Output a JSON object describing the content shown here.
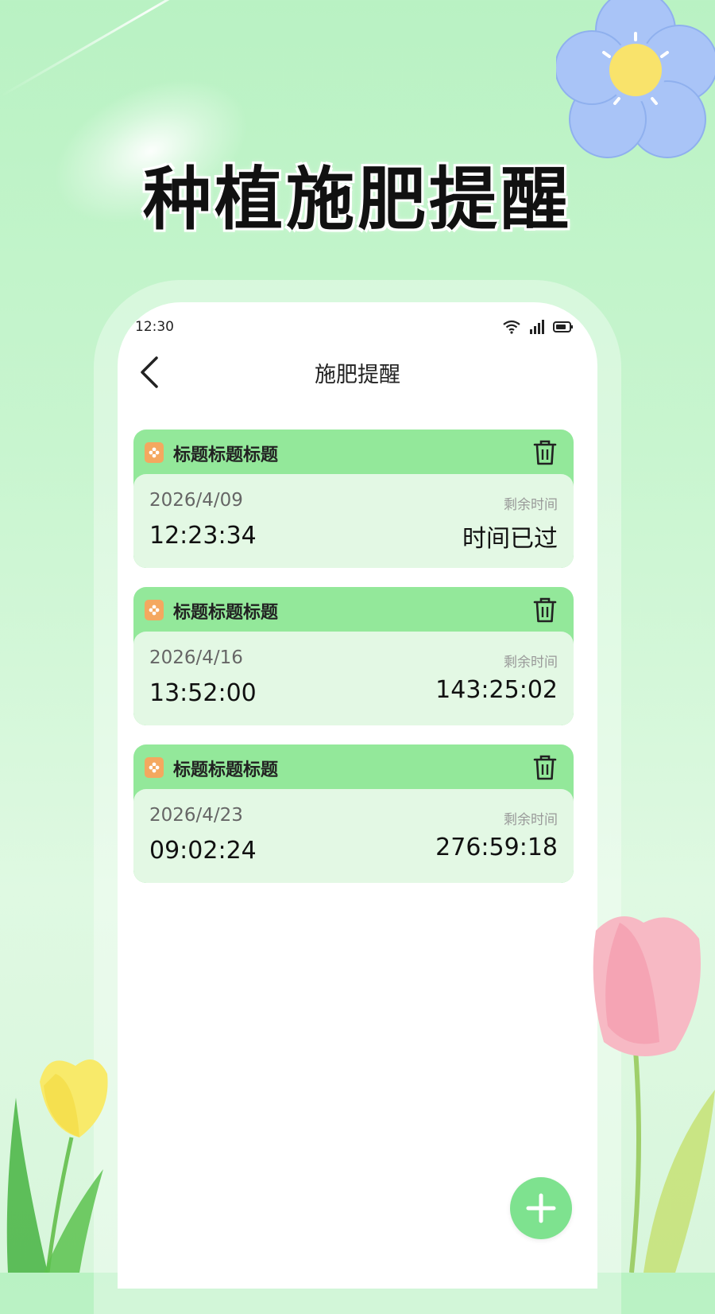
{
  "hero": {
    "title": "种植施肥提醒"
  },
  "status_bar": {
    "time": "12:30"
  },
  "nav": {
    "title": "施肥提醒"
  },
  "reminders": [
    {
      "title": "标题标题标题",
      "date": "2026/4/09",
      "time": "12:23:34",
      "remain_label": "剩余时间",
      "remain_value": "时间已过"
    },
    {
      "title": "标题标题标题",
      "date": "2026/4/16",
      "time": "13:52:00",
      "remain_label": "剩余时间",
      "remain_value": "143:25:02"
    },
    {
      "title": "标题标题标题",
      "date": "2026/4/23",
      "time": "09:02:24",
      "remain_label": "剩余时间",
      "remain_value": "276:59:18"
    }
  ],
  "icons": {
    "back": "chevron-left-icon",
    "tag": "flower-tag-icon",
    "delete": "trash-icon",
    "add": "plus-icon",
    "wifi": "wifi-icon",
    "signal": "signal-icon",
    "battery": "battery-icon"
  },
  "colors": {
    "background": "#c8f5cf",
    "card_header": "#93e89a",
    "card_body": "#e3f8e4",
    "tag_icon": "#f4a85f",
    "fab": "#7ee28f"
  }
}
